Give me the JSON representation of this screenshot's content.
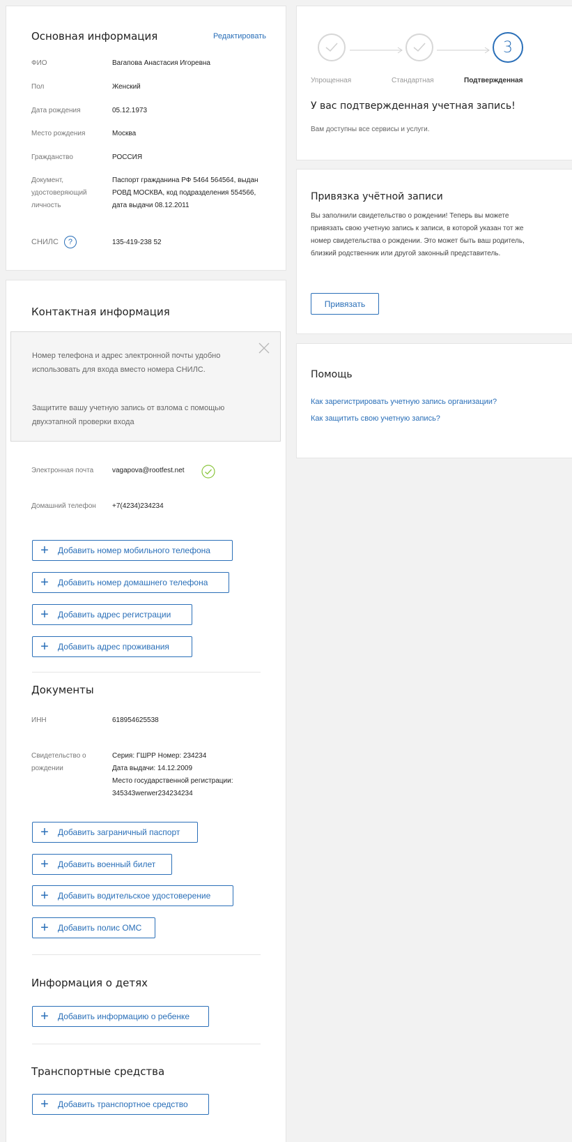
{
  "basic_info": {
    "title": "Основная информация",
    "edit_link": "Редактировать",
    "fields": [
      {
        "label": "ФИО",
        "value": "Вагапова Анастасия Игоревна"
      },
      {
        "label": "Пол",
        "value": "Женский"
      },
      {
        "label": "Дата рождения",
        "value": "05.12.1973"
      },
      {
        "label": "Место рождения",
        "value": "Москва"
      },
      {
        "label": "Гражданство",
        "value": "РОССИЯ"
      },
      {
        "label": "Документ, удостоверяющий личность",
        "value": "Паспорт гражданина РФ 5464 564564, выдан РОВД МОСКВА, код подразделения 554566, дата выдачи 08.12.2011"
      },
      {
        "label": "СНИЛС",
        "value": "135-419-238 52"
      }
    ]
  },
  "contact": {
    "title": "Контактная информация",
    "notice": {
      "p1": "Номер телефона и адрес электронной почты удобно использовать для входа вместо номера СНИЛС.",
      "p2": "Защитите вашу учетную запись от взлома с помощью двухэтапной проверки входа"
    },
    "email_label": "Электронная почта",
    "email_value": "vagapova@rootfest.net",
    "home_phone_label": "Домашний телефон",
    "home_phone_value": "+7(4234)234234",
    "buttons": [
      "Добавить номер мобильного телефона",
      "Добавить номер домашнего телефона",
      "Добавить адрес регистрации",
      "Добавить адрес проживания"
    ]
  },
  "documents": {
    "title": "Документы",
    "inn_label": "ИНН",
    "inn_value": "618954625538",
    "birth_cert_label": "Свидетельство о рождении",
    "birth_cert_lines": [
      "Серия: ГШРР Номер: 234234",
      "Дата выдачи: 14.12.2009",
      "Место государственной регистрации:",
      "345343werwer234234234"
    ],
    "buttons": [
      "Добавить заграничный паспорт",
      "Добавить военный билет",
      "Добавить водительское удостоверение",
      "Добавить полис ОМС"
    ]
  },
  "children": {
    "title": "Информация о детях",
    "button": "Добавить информацию о ребенке"
  },
  "vehicles": {
    "title": "Транспортные средства",
    "button": "Добавить транспортное средство"
  },
  "account_level": {
    "steps": [
      "Упрощенная",
      "Стандартная",
      "Подтвержденная"
    ],
    "current_step_number": "3",
    "title": "У вас подтвержденная учетная запись!",
    "text": "Вам доступны все сервисы и услуги."
  },
  "binding": {
    "title": "Привязка учётной записи",
    "text": "Вы заполнили свидетельство о рождении! Теперь вы можете привязать свою учетную запись к записи, в которой указан тот же номер свидетельства о рождении. Это может быть ваш родитель, близкий родственник или другой законный представитель.",
    "button": "Привязать"
  },
  "help": {
    "title": "Помощь",
    "links": [
      "Как зарегистрировать учетную запись организации?",
      "Как защитить свою учетную запись?"
    ]
  },
  "colors": {
    "accent": "#2a6fb8",
    "success": "#8cc63f",
    "background": "#f2f2f2"
  }
}
